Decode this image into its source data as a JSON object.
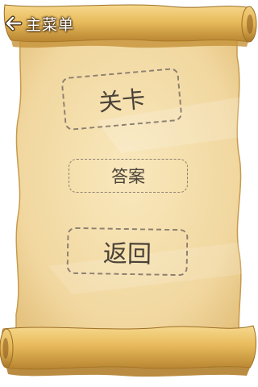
{
  "header": {
    "back_label": "主菜单",
    "back_icon": "arrow-left-icon"
  },
  "menu": {
    "levels_label": "关卡",
    "answers_label": "答案",
    "back_label": "返回"
  },
  "colors": {
    "parchment": "#f3dba6",
    "scroll_roll": "#e7bc62",
    "scroll_shadow": "#b9852d",
    "dashed_border": "#8d8070",
    "text": "#4a4238"
  }
}
